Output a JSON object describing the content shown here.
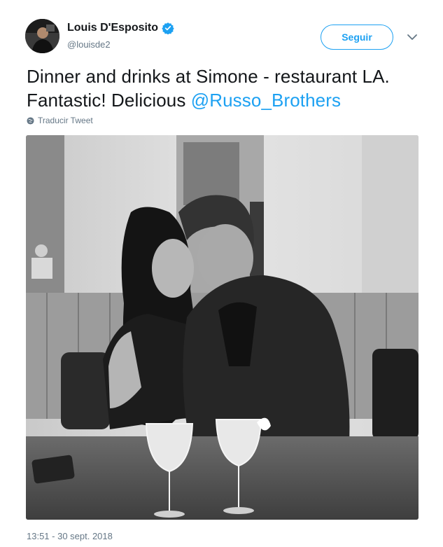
{
  "author": {
    "display_name": "Louis D'Esposito",
    "handle": "@louisde2",
    "verified": true
  },
  "actions": {
    "follow_label": "Seguir"
  },
  "tweet": {
    "text_main": "Dinner and drinks at Simone - restaurant LA. Fantastic!  Delicious ",
    "mention": "@Russo_Brothers",
    "translate_label": "Traducir Tweet",
    "timestamp": "13:51 - 30 sept. 2018"
  },
  "colors": {
    "brand_blue": "#1da1f2",
    "secondary_text": "#657786",
    "primary_text": "#14171a"
  },
  "icons": {
    "verified": "verified-badge-icon",
    "caret": "chevron-down-icon",
    "translate": "globe-icon"
  }
}
